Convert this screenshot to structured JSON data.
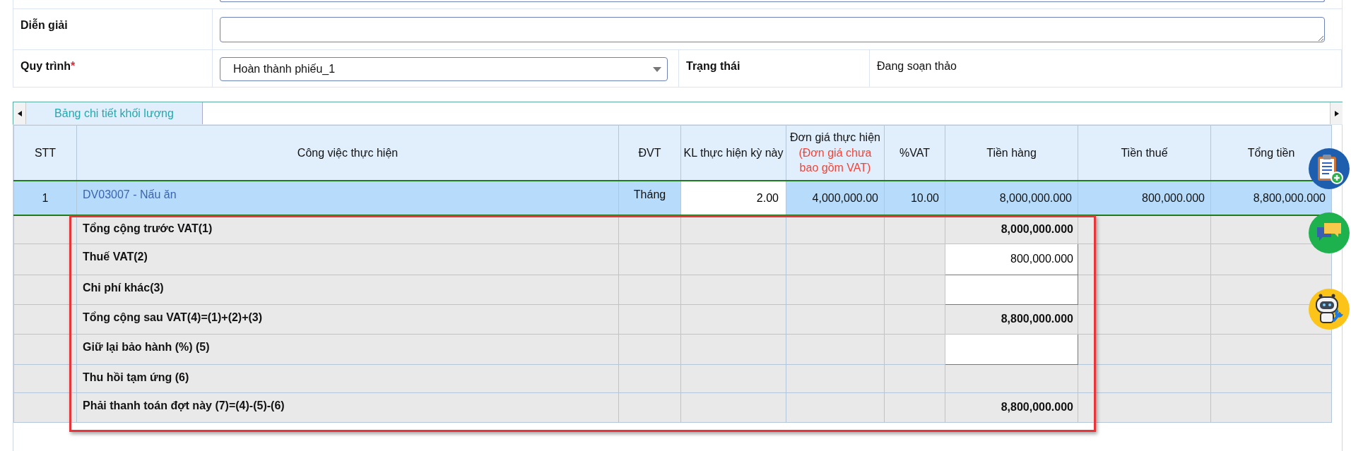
{
  "form": {
    "fields": [
      {
        "kind": "textarea",
        "label": "Diễn giải"
      },
      {
        "kind": "select",
        "label": "Quy trình",
        "required_mark": "*",
        "value": "Hoàn thành phiếu_1"
      },
      {
        "kind": "text",
        "label": "Trạng thái",
        "value": "Đang soạn thảo"
      }
    ]
  },
  "tabs": [
    {
      "label": "Bảng chi tiết khối lượng",
      "selected": true
    }
  ],
  "table": {
    "columns": [
      {
        "label": "STT"
      },
      {
        "label": "Công việc thực hiện"
      },
      {
        "label": "ĐVT"
      },
      {
        "label": "KL thực hiện kỳ này",
        "editable": true
      },
      {
        "label": "Đơn giá thực hiện",
        "note": "(Đơn giá chưa bao gồm VAT)"
      },
      {
        "label": "%VAT"
      },
      {
        "label": "Tiền hàng"
      },
      {
        "label": "Tiền thuế"
      },
      {
        "label": "Tổng tiền"
      }
    ],
    "rows": [
      {
        "selected": true,
        "cells": [
          "1",
          "DV03007 - Nấu ăn",
          "Tháng",
          "2.00",
          "4,000,000.00",
          "10.00",
          "8,000,000.000",
          "800,000.000",
          "8,800,000.000"
        ]
      }
    ],
    "summary": [
      {
        "kind": "total",
        "label": "Tổng cộng trước VAT(1)",
        "value": "8,000,000.000"
      },
      {
        "kind": "input",
        "label": "Thuế VAT(2)",
        "value": "800,000.000"
      },
      {
        "kind": "input",
        "label": "Chi phí khác(3)"
      },
      {
        "kind": "total",
        "label": "Tổng cộng sau VAT(4)=(1)+(2)+(3)",
        "value": "8,800,000.000"
      },
      {
        "kind": "input",
        "label": "Giữ lại bảo hành (%) (5)"
      },
      {
        "kind": "total",
        "label": "Thu hồi tạm ứng (6)"
      },
      {
        "kind": "total",
        "label": "Phải thanh toán đợt này (7)=(4)-(5)-(6)",
        "value": "8,800,000.000"
      }
    ]
  }
}
